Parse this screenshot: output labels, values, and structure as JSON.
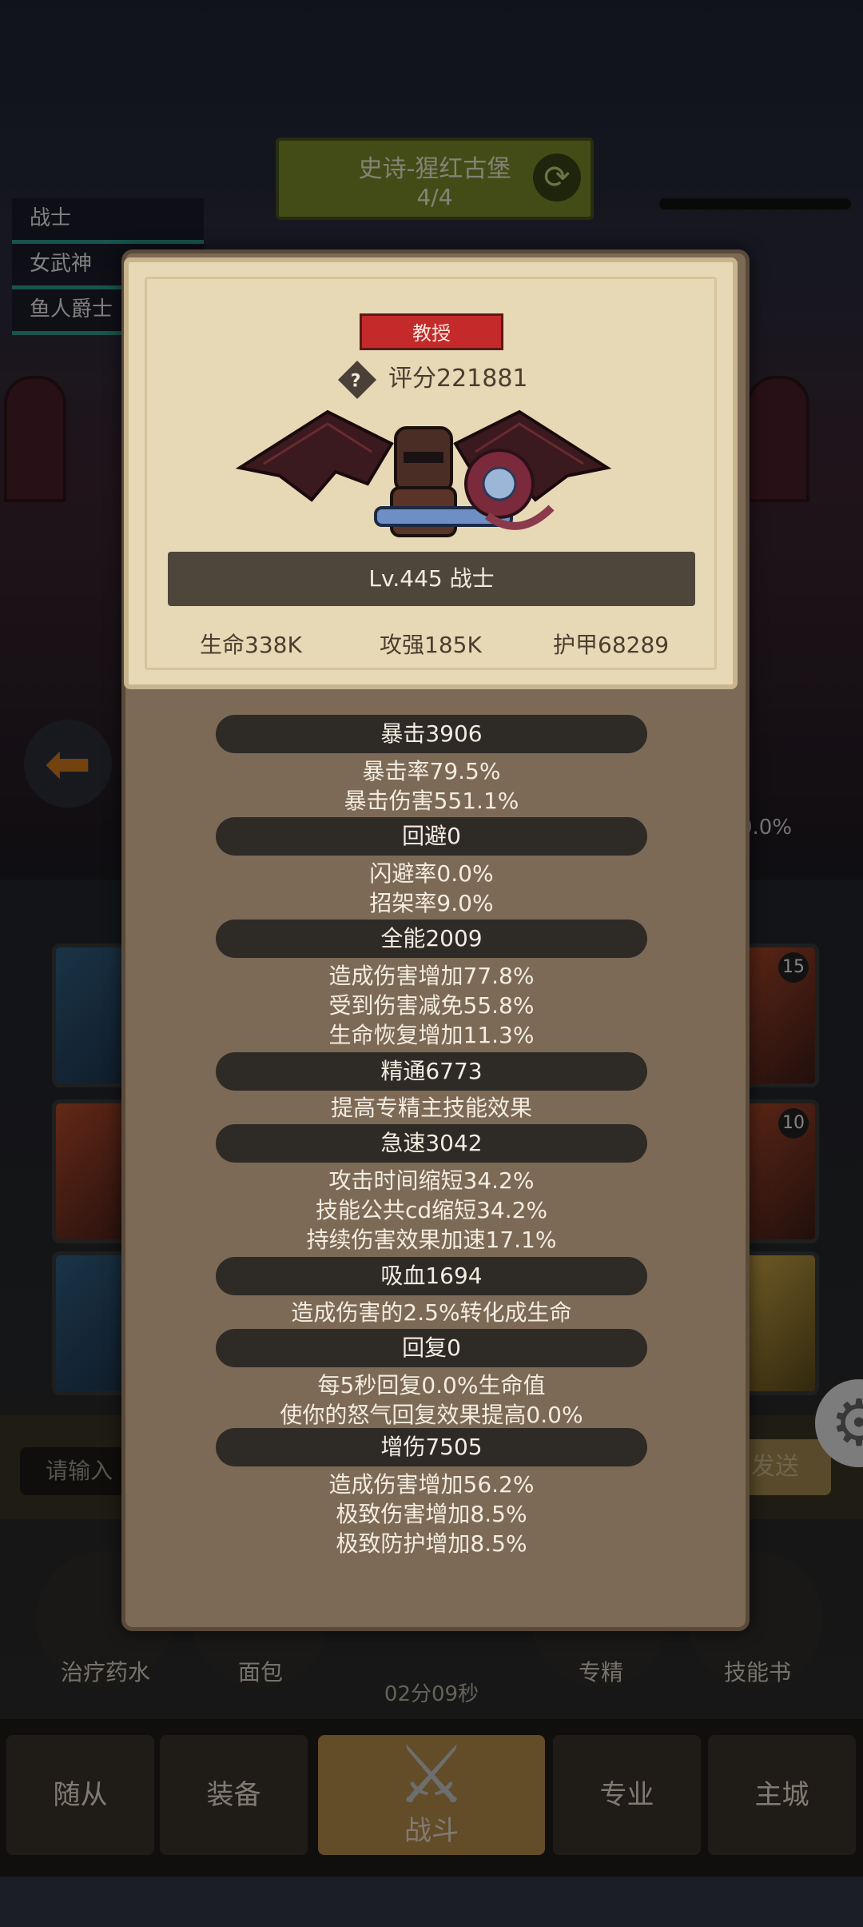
{
  "background": {
    "dungeon": {
      "name": "史诗-猩红古堡",
      "progress": "4/4"
    },
    "team": [
      "战士",
      "女武神",
      "鱼人爵士"
    ],
    "right_percent": "0.0%",
    "skill_badges": [
      "15",
      "10"
    ],
    "chat": {
      "placeholder": "请输入",
      "send_label": "发送"
    },
    "items": [
      "治疗药水",
      "面包",
      "专精",
      "技能书"
    ],
    "timer": "02分09秒",
    "nav": [
      "随从",
      "装备",
      "战斗",
      "专业",
      "主城"
    ]
  },
  "character": {
    "title_badge": "教授",
    "score": "评分221881",
    "level_name": "Lv.445 战士",
    "summary": {
      "hp": "生命338K",
      "attack": "攻强185K",
      "armor": "护甲68289"
    }
  },
  "sections": [
    {
      "header": "暴击3906",
      "lines": [
        "暴击率79.5%",
        "暴击伤害551.1%"
      ]
    },
    {
      "header": "回避0",
      "lines": [
        "闪避率0.0%",
        "招架率9.0%"
      ]
    },
    {
      "header": "全能2009",
      "lines": [
        "造成伤害增加77.8%",
        "受到伤害减免55.8%",
        "生命恢复增加11.3%"
      ]
    },
    {
      "header": "精通6773",
      "lines": [
        "提高专精主技能效果"
      ]
    },
    {
      "header": "急速3042",
      "lines": [
        "攻击时间缩短34.2%",
        "技能公共cd缩短34.2%",
        "持续伤害效果加速17.1%"
      ]
    },
    {
      "header": "吸血1694",
      "lines": [
        "造成伤害的2.5%转化成生命"
      ]
    },
    {
      "header": "回复0",
      "lines": [
        "每5秒回复0.0%生命值",
        "使你的怒气回复效果提高0.0%"
      ]
    },
    {
      "header": "增伤7505",
      "lines": [
        "造成伤害增加56.2%",
        "极致伤害增加8.5%",
        "极致防护增加8.5%"
      ]
    }
  ],
  "colors": {
    "accent": "#c42a2a",
    "panel": "#7c6a56",
    "parchment": "#e8d9b6"
  }
}
